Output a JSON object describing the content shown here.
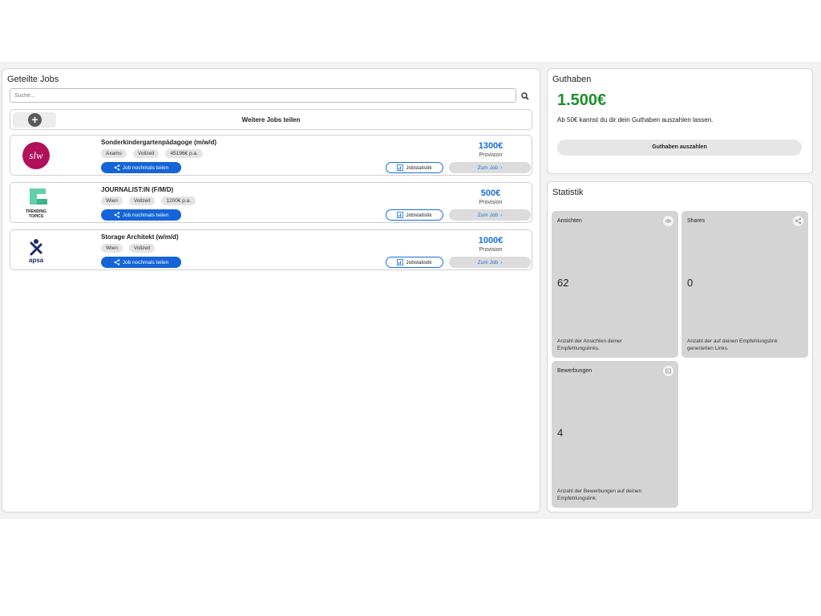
{
  "jobs_panel": {
    "title": "Geteilte Jobs",
    "search_placeholder": "Suche...",
    "share_more_label": "Weitere Jobs teilen",
    "jobs": [
      {
        "title": "Sonderkindergartenpädagoge (m/w/d)",
        "tags": [
          "Axams",
          "Vollzeit",
          "45196€ p.a."
        ],
        "amount": "1300€",
        "provision_label": "Provision",
        "share_label": "Job nochmals teilen",
        "stats_label": "Jobstatistik",
        "goto_label": "Zum Job",
        "logo_text": "slw",
        "logo_icon": "slw-logo"
      },
      {
        "title": "JOURNALIST:IN (F/M/D)",
        "tags": [
          "Wien",
          "Vollzeit",
          "1200€ p.a."
        ],
        "amount": "500€",
        "provision_label": "Provision",
        "share_label": "Job nochmals teilen",
        "stats_label": "Jobstatistik",
        "goto_label": "Zum Job",
        "logo_text": "TRENDING TOPICS",
        "logo_icon": "trending-topics-logo"
      },
      {
        "title": "Storage Architekt (w/m/d)",
        "tags": [
          "Wien",
          "Vollzeit"
        ],
        "amount": "1000€",
        "provision_label": "Provision",
        "share_label": "Job nochmals teilen",
        "stats_label": "Jobstatistik",
        "goto_label": "Zum Job",
        "logo_text": "apsa",
        "logo_icon": "apsa-logo"
      }
    ]
  },
  "credit_panel": {
    "title": "Guthaben",
    "amount": "1.500€",
    "note": "Ab 50€ kannst du dir dein Guthaben auszahlen lassen.",
    "payout_label": "Guthaben auszahlen"
  },
  "stats_panel": {
    "title": "Statistik",
    "tiles": [
      {
        "label": "Ansichten",
        "value": "62",
        "description": "Anzahl der Ansichten deiner Empfehlungslinks.",
        "icon": "eye-icon"
      },
      {
        "label": "Shares",
        "value": "0",
        "description": "Anzahl der auf deinen Empfehlungslink generierten Links.",
        "icon": "share-icon"
      },
      {
        "label": "Bewerbungen",
        "value": "4",
        "description": "Anzahl der Bewerbungen auf deinen Empfehlungslink.",
        "icon": "application-icon"
      }
    ]
  },
  "colors": {
    "primary_blue": "#1565d8",
    "amount_blue": "#1a6fd8",
    "credit_green": "#1e8e2c",
    "tile_grey": "#d4d4d4",
    "slw_magenta": "#b0115a",
    "trending_green": "#5fd1a6",
    "apsa_navy": "#1b2a6b"
  }
}
